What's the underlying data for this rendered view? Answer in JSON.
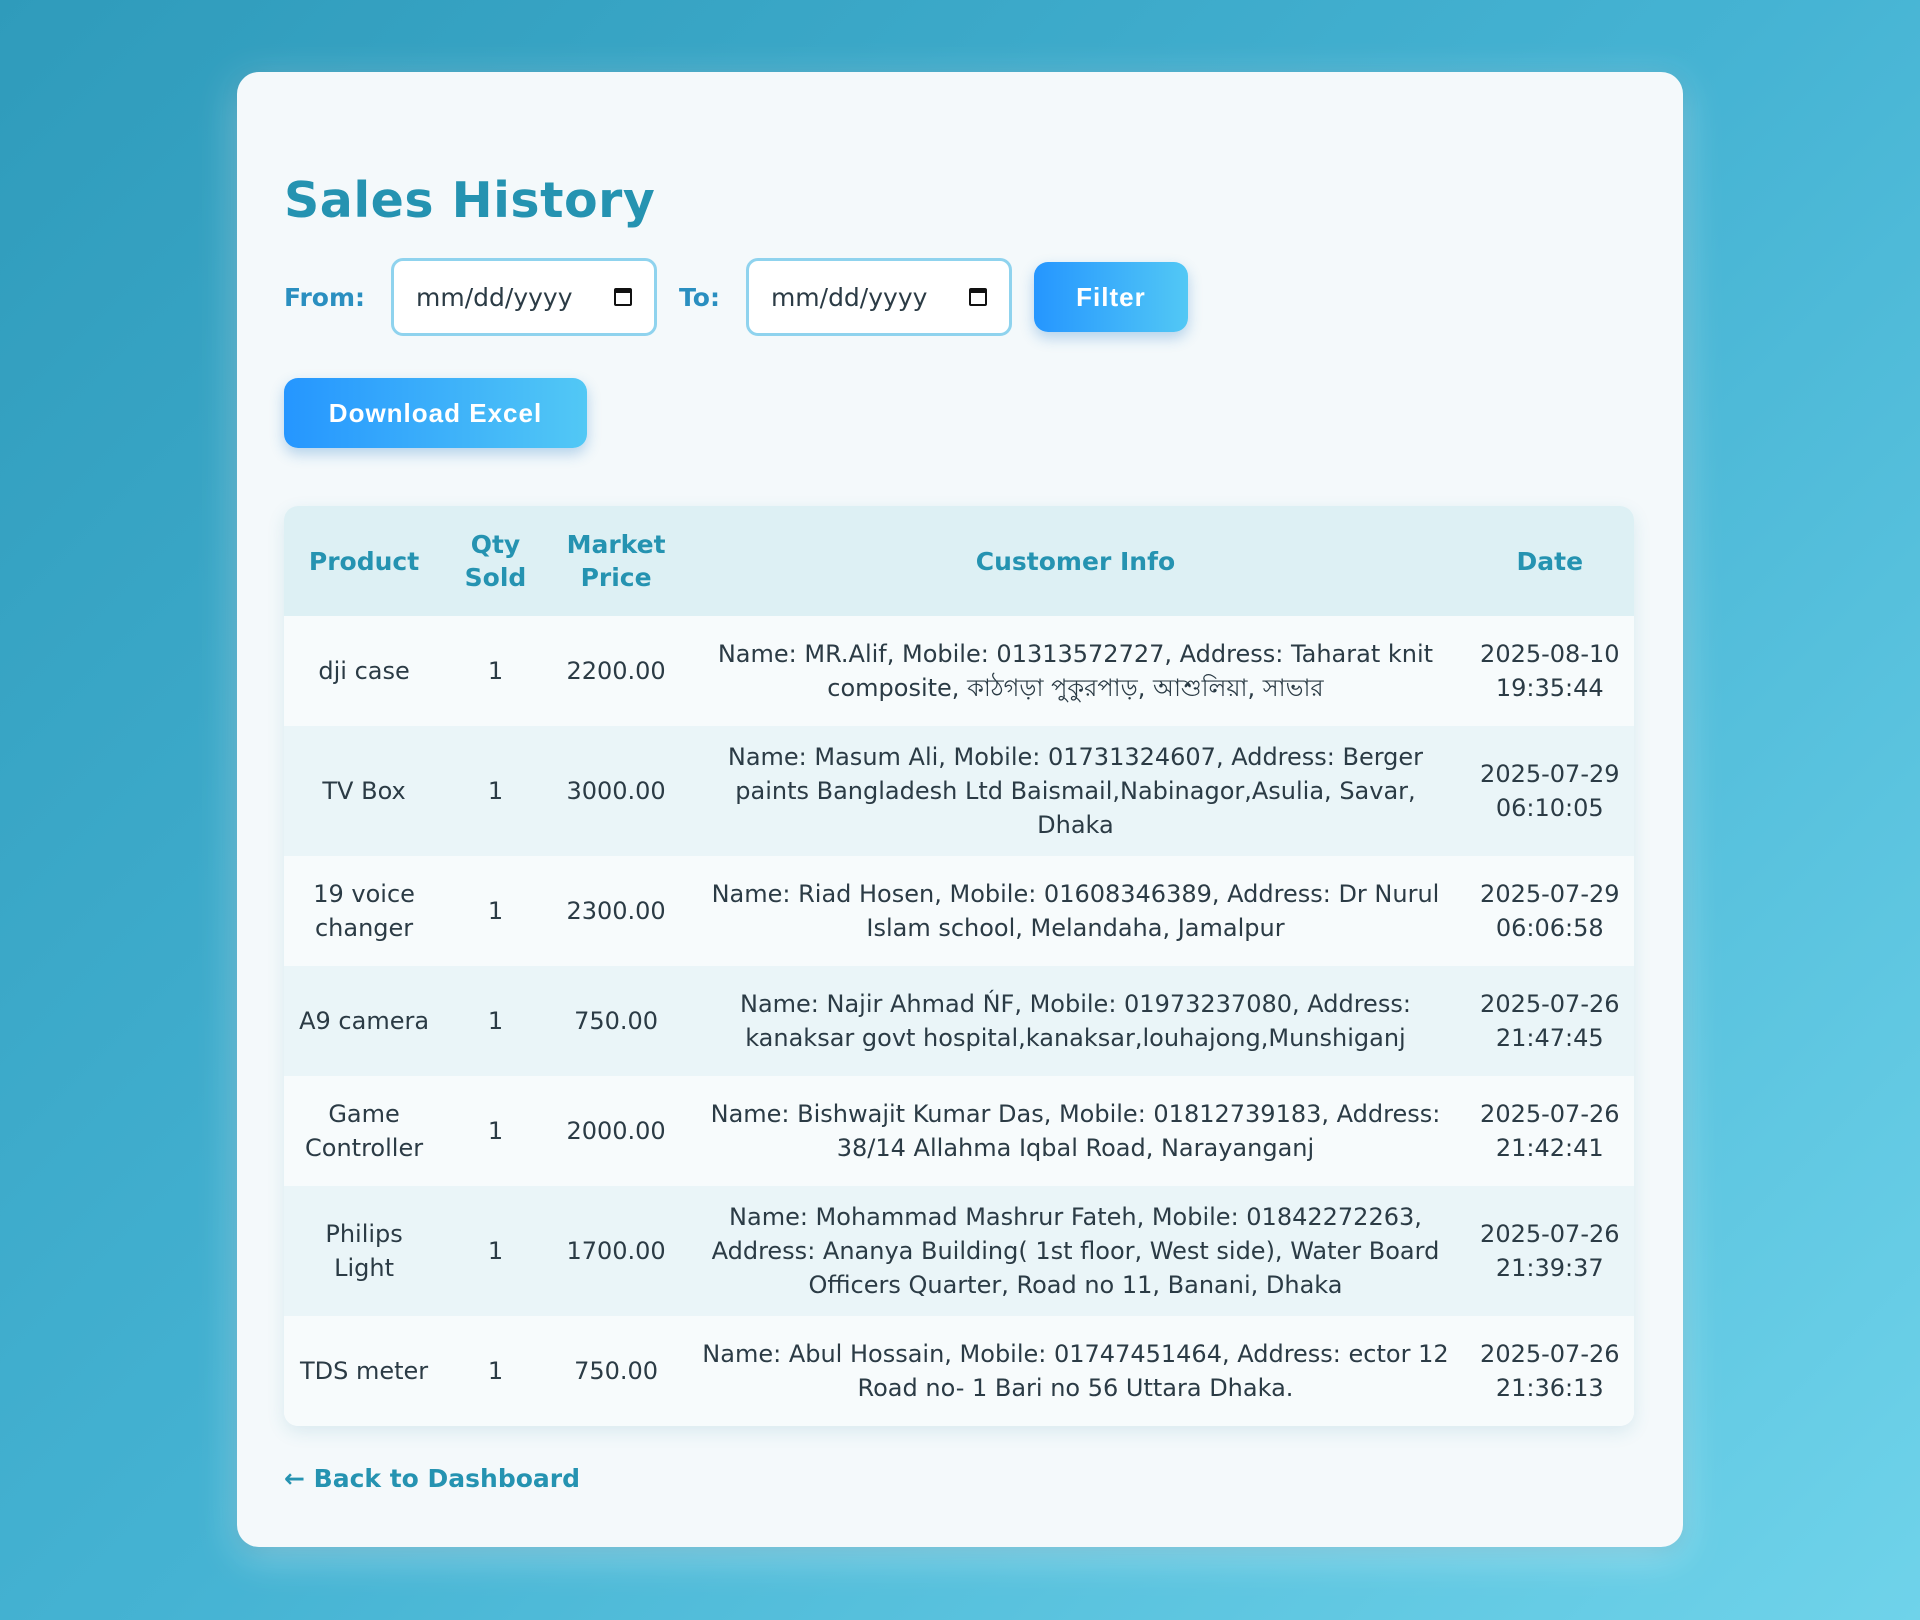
{
  "page": {
    "title": "Sales History"
  },
  "filter": {
    "from_label": "From:",
    "to_label": "To:",
    "from_placeholder": "mm/dd/yyyy",
    "to_placeholder": "mm/dd/yyyy",
    "button_label": "Filter"
  },
  "actions": {
    "download_label": "Download Excel"
  },
  "table": {
    "headers": {
      "product": "Product",
      "qty_line1": "Qty",
      "qty_line2": "Sold",
      "price_line1": "Market",
      "price_line2": "Price",
      "customer": "Customer Info",
      "date": "Date"
    },
    "rows": [
      {
        "product": "dji case",
        "qty": "1",
        "price": "2200.00",
        "customer": "Name: MR.Alif, Mobile: 01313572727, Address: Taharat knit composite, কাঠগড়া পুকুরপাড়, আশুলিয়া, সাভার",
        "date": "2025-08-10 19:35:44"
      },
      {
        "product": "TV Box",
        "qty": "1",
        "price": "3000.00",
        "customer": "Name: Masum Ali, Mobile: 01731324607, Address: Berger paints Bangladesh Ltd Baismail,Nabinagor,Asulia, Savar, Dhaka",
        "date": "2025-07-29 06:10:05"
      },
      {
        "product": "19 voice changer",
        "qty": "1",
        "price": "2300.00",
        "customer": "Name: Riad Hosen, Mobile: 01608346389, Address: Dr Nurul Islam school, Melandaha, Jamalpur",
        "date": "2025-07-29 06:06:58"
      },
      {
        "product": "A9 camera",
        "qty": "1",
        "price": "750.00",
        "customer": "Name: Najir Ahmad ŃF, Mobile: 01973237080, Address: kanaksar govt hospital,kanaksar,louhajong,Munshiganj",
        "date": "2025-07-26 21:47:45"
      },
      {
        "product": "Game Controller",
        "qty": "1",
        "price": "2000.00",
        "customer": "Name: Bishwajit Kumar Das, Mobile: 01812739183, Address: 38/14 Allahma Iqbal Road, Narayanganj",
        "date": "2025-07-26 21:42:41"
      },
      {
        "product": "Philips Light",
        "qty": "1",
        "price": "1700.00",
        "customer": "Name: Mohammad Mashrur Fateh, Mobile: 01842272263, Address: Ananya Building( 1st floor, West side), Water Board Officers Quarter, Road no 11, Banani, Dhaka",
        "date": "2025-07-26 21:39:37"
      },
      {
        "product": "TDS meter",
        "qty": "1",
        "price": "750.00",
        "customer": "Name: Abul Hossain, Mobile: 01747451464, Address: ector 12 Road no- 1 Bari no 56 Uttara Dhaka.",
        "date": "2025-07-26 21:36:13"
      }
    ]
  },
  "footer": {
    "back_link": "← Back to Dashboard"
  }
}
